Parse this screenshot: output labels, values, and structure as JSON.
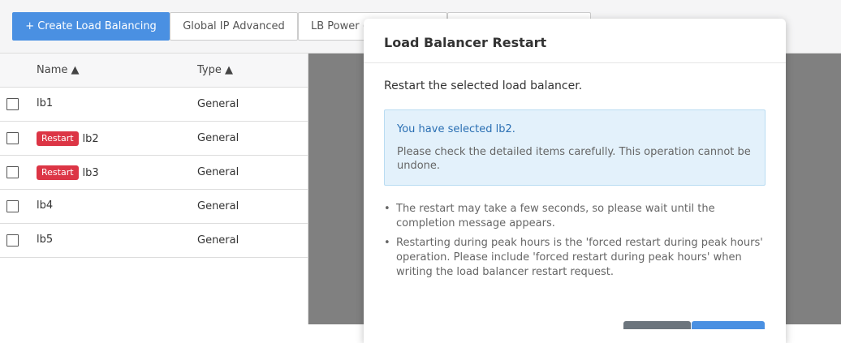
{
  "toolbar": {
    "create_label": "+ Create Load Balancing",
    "global_ip_label": "Global IP Advanced",
    "lb_power_label": "LB Power (",
    "fourth_label": ""
  },
  "table": {
    "headers": {
      "name": "Name ▲",
      "type": "Type ▲"
    },
    "rows": [
      {
        "name": "lb1",
        "type": "General",
        "tag": ""
      },
      {
        "name": "lb2",
        "type": "General",
        "tag": "Restart"
      },
      {
        "name": "lb3",
        "type": "General",
        "tag": "Restart"
      },
      {
        "name": "lb4",
        "type": "General",
        "tag": ""
      },
      {
        "name": "lb5",
        "type": "General",
        "tag": ""
      }
    ]
  },
  "modal": {
    "title": "Load Balancer Restart",
    "description": "Restart the selected load balancer.",
    "selected_text": "You have selected lb2.",
    "warning_text": "Please check the detailed items carefully. This operation cannot be undone.",
    "notes": [
      "The restart may take a few seconds, so please wait until the completion message appears.",
      "Restarting during peak hours is the 'forced restart during peak hours' operation. Please include 'forced restart during peak hours' when writing the load balancer restart request."
    ]
  },
  "colors": {
    "primary": "#4a90e2",
    "danger": "#dc3545",
    "overlay": "#808080",
    "info_bg": "#e3f1fb"
  }
}
